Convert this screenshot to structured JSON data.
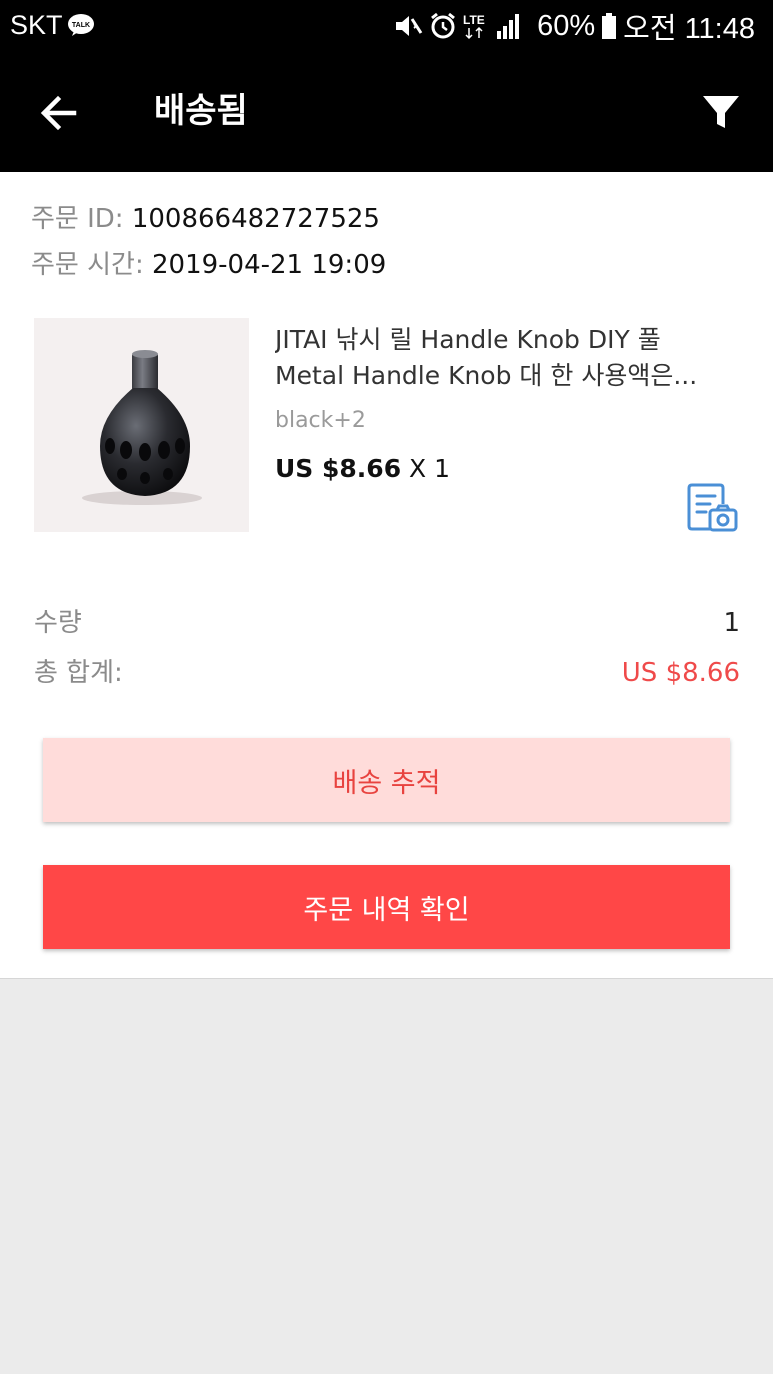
{
  "status_bar": {
    "carrier": "SKT",
    "talk_badge": "TALK",
    "network": "LTE",
    "battery": "60%",
    "time": "오전 11:48"
  },
  "app_bar": {
    "title": "배송됨"
  },
  "order": {
    "id_label": "주문 ID: ",
    "id_value": "100866482727525",
    "time_label": "주문 시간: ",
    "time_value": "2019-04-21 19:09"
  },
  "product": {
    "title": "JITAI 낚시 릴 Handle Knob DIY 풀 Metal Handle Knob 대 한 사용액은...",
    "variant": "black+2",
    "price": "US $8.66",
    "quantity": " X 1"
  },
  "summary": {
    "qty_label": "수량",
    "qty_value": "1",
    "total_label": "총 합계:",
    "total_value": "US $8.66"
  },
  "buttons": {
    "track": "배송 추적",
    "details": "주문 내역 확인"
  },
  "icons": {
    "back": "arrow-left-icon",
    "filter": "filter-icon",
    "review": "photo-review-icon"
  },
  "colors": {
    "accent": "#ff4747",
    "accent_light": "#ffdcda",
    "price_red": "#ef4a4a",
    "review_blue": "#4a8fd6"
  }
}
